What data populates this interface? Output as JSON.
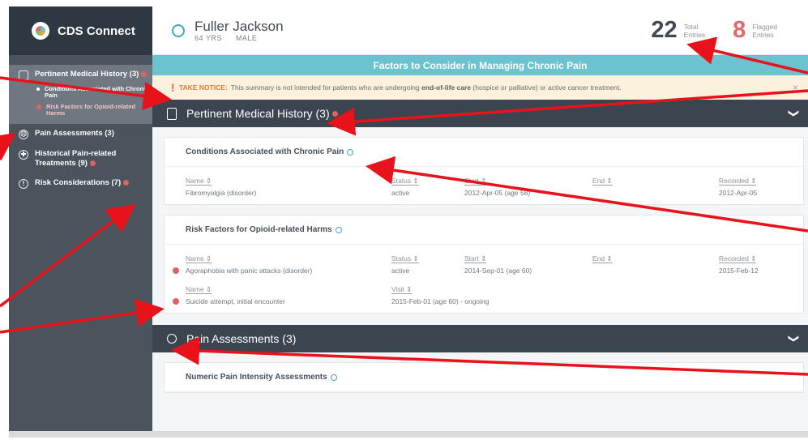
{
  "app": {
    "name": "CDS Connect"
  },
  "sidebar": {
    "items": [
      {
        "label": "Pertinent Medical History (3)",
        "flagged": true
      },
      {
        "label": "Pain Assessments (3)",
        "flagged": false
      },
      {
        "label": "Historical Pain-related Treatments (9)",
        "flagged": true
      },
      {
        "label": "Risk Considerations (7)",
        "flagged": true
      }
    ],
    "sub_items": [
      {
        "label": "Conditions Associated with Chronic Pain",
        "flagged": false
      },
      {
        "label": "Risk Factors for Opioid-related Harms",
        "flagged": true
      }
    ]
  },
  "patient": {
    "name": "Fuller Jackson",
    "age": "64 YRS",
    "gender": "MALE"
  },
  "stats": {
    "total": {
      "value": "22",
      "label_line1": "Total",
      "label_line2": "Entries"
    },
    "flagged": {
      "value": "8",
      "label_line1": "Flagged",
      "label_line2": "Entries"
    }
  },
  "banner": {
    "title": "Factors to Consider in Managing Chronic Pain"
  },
  "notice": {
    "label": "TAKE NOTICE:",
    "text_before": "This summary is not intended for patients who are undergoing",
    "emphasis": "end-of-life care",
    "text_after": "(hospice or palliative) or active cancer treatment.",
    "close": "×"
  },
  "sections": {
    "history": {
      "title": "Pertinent Medical History (3)",
      "chevron": "❯"
    },
    "pain": {
      "title": "Pain Assessments (3)",
      "chevron": "❯"
    }
  },
  "conditions": {
    "title": "Conditions Associated with Chronic Pain",
    "headers": [
      "Name ⇕",
      "Status ⇕",
      "Start ⇕",
      "End ⇕",
      "Recorded ⇕"
    ],
    "rows": [
      {
        "name": "Fibromyalgia (disorder)",
        "status": "active",
        "start": "2012-Apr-05 (age 58)",
        "end": "",
        "recorded": "2012-Apr-05"
      }
    ]
  },
  "risk_factors": {
    "title": "Risk Factors for Opioid-related Harms",
    "headers": [
      "Name ⇕",
      "Status ⇕",
      "Start ⇕",
      "End ⇕",
      "Recorded ⇕"
    ],
    "rows": [
      {
        "name": "Agoraphobia with panic attacks (disorder)",
        "status": "active",
        "start": "2014-Sep-01 (age 60)",
        "end": "",
        "recorded": "2015-Feb-12"
      }
    ],
    "headers2": [
      "Name ⇕",
      "Visit ⇕"
    ],
    "rows2": [
      {
        "name": "Suicide attempt, initial encounter",
        "visit": "2015-Feb-01 (age 60) - ongoing"
      }
    ]
  },
  "pain_card": {
    "title": "Numeric Pain Intensity Assessments"
  },
  "colors": {
    "sidebar": "#4b535c",
    "header_dark": "#3b4550",
    "accent": "#6cc3d0",
    "flag": "#e06161",
    "arrow": "#e8121b"
  }
}
